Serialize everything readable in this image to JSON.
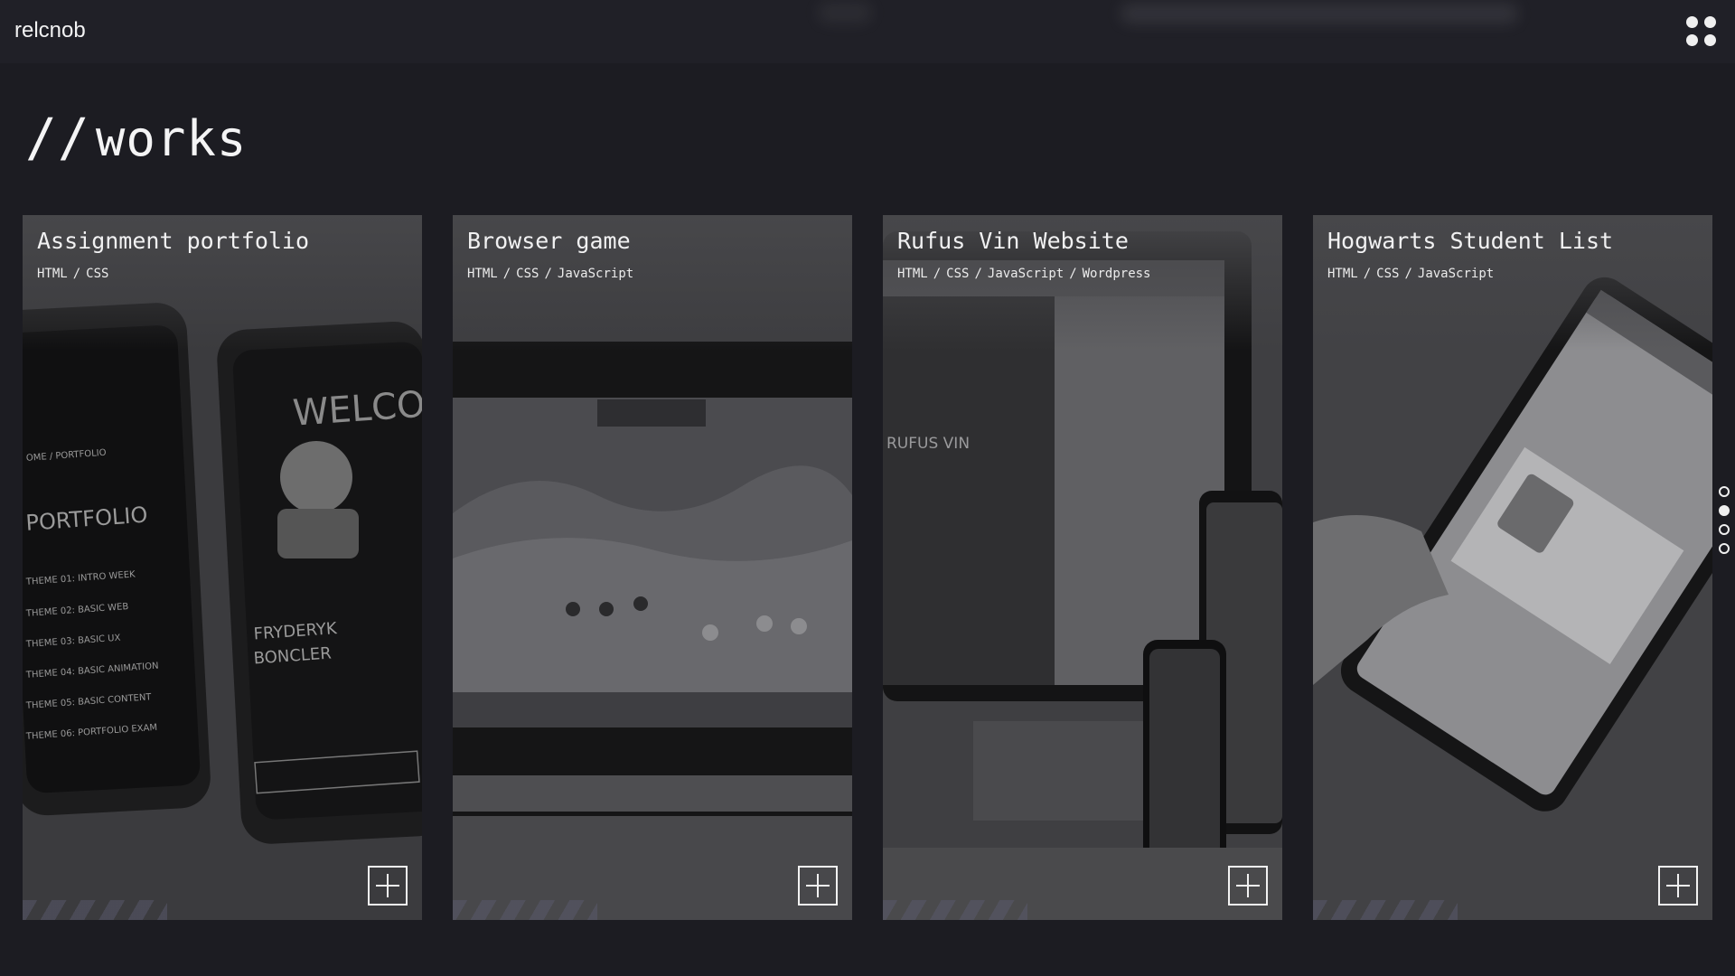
{
  "header": {
    "logo": "relcnob",
    "menu_icon": "dots-grid-icon"
  },
  "page": {
    "heading_prefix": "//",
    "heading": "works"
  },
  "cards": [
    {
      "title": "Assignment portfolio",
      "tags": [
        "HTML",
        "CSS"
      ],
      "action_icon": "plus-icon"
    },
    {
      "title": "Browser game",
      "tags": [
        "HTML",
        "CSS",
        "JavaScript"
      ],
      "action_icon": "plus-icon"
    },
    {
      "title": "Rufus Vin Website",
      "tags": [
        "HTML",
        "CSS",
        "JavaScript",
        "Wordpress"
      ],
      "action_icon": "plus-icon"
    },
    {
      "title": "Hogwarts Student List",
      "tags": [
        "HTML",
        "CSS",
        "JavaScript"
      ],
      "action_icon": "plus-icon"
    }
  ],
  "pagination": {
    "count": 4,
    "active": 2
  },
  "colors": {
    "background": "#1c1c22",
    "card": "#3a3a3d",
    "text": "#f1f1f2"
  }
}
